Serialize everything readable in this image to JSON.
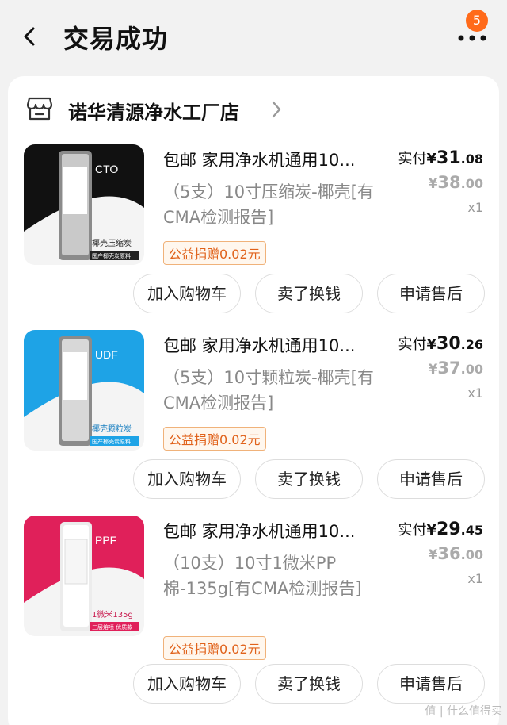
{
  "header": {
    "title": "交易成功",
    "badge_count": "5"
  },
  "store": {
    "name": "诺华清源净水工厂店"
  },
  "orders": [
    {
      "thumb_caption": "CTO",
      "thumb_sub": "椰壳压缩炭",
      "thumb_tag": "国产椰壳炭原料",
      "thumb_color": "#111111",
      "title": "包邮 家用净水机通用10...",
      "spec": "（5支）10寸压缩炭-椰壳[有CMA检测报告]",
      "paid_label": "实付",
      "paid_yen": "¥",
      "paid_int": "31",
      "paid_dec": ".08",
      "orig_yen": "¥",
      "orig_int": "38",
      "orig_dec": ".00",
      "qty": "x1",
      "charity": "公益捐赠0.02元",
      "btn_cart": "加入购物车",
      "btn_sell": "卖了换钱",
      "btn_service": "申请售后"
    },
    {
      "thumb_caption": "UDF",
      "thumb_sub": "椰壳颗粒炭",
      "thumb_tag": "国产椰壳炭原料",
      "thumb_color": "#1ea3e6",
      "title": "包邮 家用净水机通用10...",
      "spec": "（5支）10寸颗粒炭-椰壳[有CMA检测报告]",
      "paid_label": "实付",
      "paid_yen": "¥",
      "paid_int": "30",
      "paid_dec": ".26",
      "orig_yen": "¥",
      "orig_int": "37",
      "orig_dec": ".00",
      "qty": "x1",
      "charity": "公益捐赠0.02元",
      "btn_cart": "加入购物车",
      "btn_sell": "卖了换钱",
      "btn_service": "申请售后"
    },
    {
      "thumb_caption": "PPF",
      "thumb_sub": "1微米135g",
      "thumb_tag": "三层熔喷·优质款",
      "thumb_color": "#e0205a",
      "title": "包邮 家用净水机通用10...",
      "spec": "（10支）10寸1微米PP棉-135g[有CMA检测报告]",
      "paid_label": "实付",
      "paid_yen": "¥",
      "paid_int": "29",
      "paid_dec": ".45",
      "orig_yen": "¥",
      "orig_int": "36",
      "orig_dec": ".00",
      "qty": "x1",
      "charity": "公益捐赠0.02元",
      "btn_cart": "加入购物车",
      "btn_sell": "卖了换钱",
      "btn_service": "申请售后"
    }
  ],
  "watermark": "值 | 什么值得买"
}
